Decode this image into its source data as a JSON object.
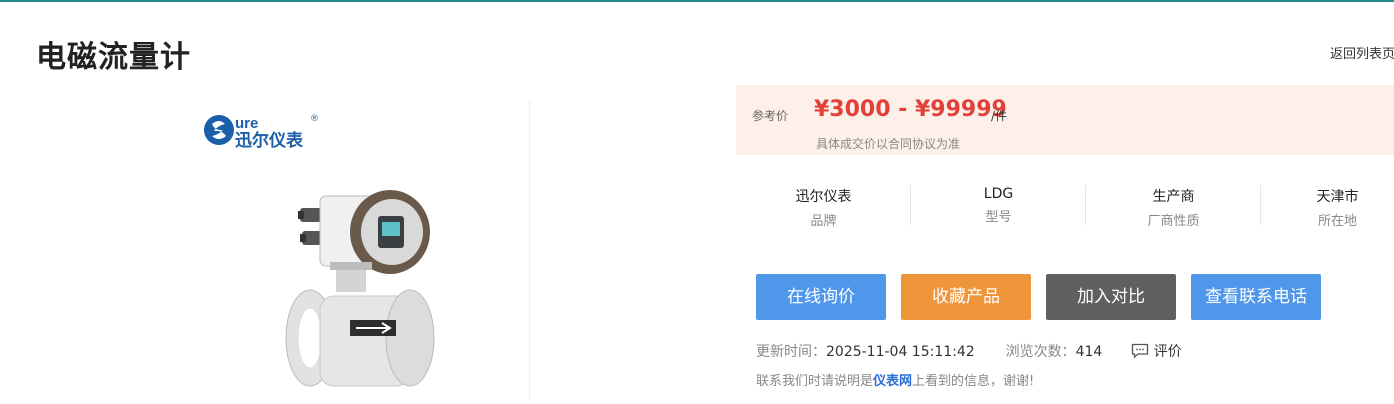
{
  "page": {
    "title": "电磁流量计",
    "back_link": "返回列表页"
  },
  "logo": {
    "text": "迅尔仪表",
    "mark": "ure"
  },
  "price": {
    "label": "参考价",
    "value": "¥3000 - ¥99999",
    "unit": "/件",
    "note": "具体成交价以合同协议为准"
  },
  "specs": [
    {
      "value": "迅尔仪表",
      "label": "品牌"
    },
    {
      "value": "LDG",
      "label": "型号"
    },
    {
      "value": "生产商",
      "label": "厂商性质"
    },
    {
      "value": "天津市",
      "label": "所在地"
    }
  ],
  "buttons": {
    "inquiry": "在线询价",
    "favorite": "收藏产品",
    "compare": "加入对比",
    "phone": "查看联系电话"
  },
  "meta": {
    "update_label": "更新时间：",
    "update_value": "2025-11-04 15:11:42",
    "views_label": "浏览次数：",
    "views_value": "414",
    "review_label": "评价"
  },
  "contact": {
    "prefix": "联系我们时请说明是",
    "brand": "仪表网",
    "suffix": "上看到的信息，谢谢!"
  },
  "colors": {
    "price_red": "#e2403a",
    "inquiry_blue": "#4f97ea",
    "favorite_orange": "#f0963a",
    "compare_gray": "#606060",
    "phone_blue": "#4f97ea"
  }
}
